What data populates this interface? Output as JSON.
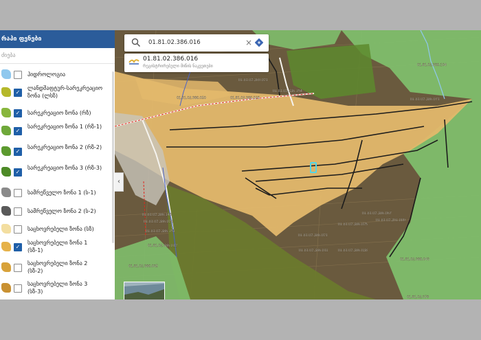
{
  "sidebar": {
    "header": "რაპი ფენები",
    "search_placeholder": "ძიება",
    "layers": [
      {
        "label": "ჰიდროლოგია",
        "checked": false,
        "color": "#8fc8ee"
      },
      {
        "label": "ლანდშაფტურ-სარეკრეაციო ზონა (ლსზ)",
        "checked": true,
        "color": "#b5b82a"
      },
      {
        "label": "სარეკრეაციო ზონა (რზ)",
        "checked": true,
        "color": "#88b63d"
      },
      {
        "label": "სარეკრეაციო ზონა 1 (რზ-1)",
        "checked": true,
        "color": "#6fa83a"
      },
      {
        "label": "სარეკრეაციო ზონა 2 (რზ-2)",
        "checked": true,
        "color": "#5c9a2f"
      },
      {
        "label": "სარეკრეაციო ზონა 3 (რზ-3)",
        "checked": true,
        "color": "#4d8a27"
      },
      {
        "label": "სამრეწველო ზონა 1 (ს-1)",
        "checked": false,
        "color": "#8a8a8a"
      },
      {
        "label": "სამრეწველო ზონა 2 (ს-2)",
        "checked": false,
        "color": "#5a5a5a"
      },
      {
        "label": "საცხოვრებელი ზონა (სზ)",
        "checked": false,
        "color": "#f3dea0"
      },
      {
        "label": "საცხოვრებელი ზონა 1 (სზ-1)",
        "checked": true,
        "color": "#e6b24a"
      },
      {
        "label": "საცხოვრებელი ზონა 2 (სზ-2)",
        "checked": false,
        "color": "#d8a23a"
      },
      {
        "label": "საცხოვრებელი ზონა 3 (სზ-3)",
        "checked": false,
        "color": "#c99132"
      }
    ]
  },
  "search": {
    "value": "01.81.02.386.016",
    "result_title": "01.81.02.386.016",
    "result_subtitle": "რეგისტრირებული მიწის ნაკვეთები"
  },
  "map_labels": [
    "01.81.02.386.016",
    "01.81.02.369.021",
    "01.81.02.336.154",
    "01.81.02.386.026",
    "01.81.02.386.050",
    "01.81.02.386.071",
    "01.81.02.386.067",
    "01.81.02.391.009",
    "01.81.02.386.025",
    "01.81.02.386.021",
    "01.81.02.386.148",
    "01.81.02.386.024",
    "01.81.02.386.151",
    "01.81.02.386.012",
    "01.81.02.386.011",
    "01.81.02.386.038",
    "01.81.02.386.043",
    "01.81.02.386.035",
    "01.81.02.378",
    "01.81.02.389.104"
  ],
  "colors": {
    "residential_zone": "#e3b86c",
    "recreational_zone": "#7fbe6c",
    "landscape_zone": "#6c7a2d",
    "selected_parcel": "#4fd6ea",
    "header": "#2b5c9a"
  }
}
